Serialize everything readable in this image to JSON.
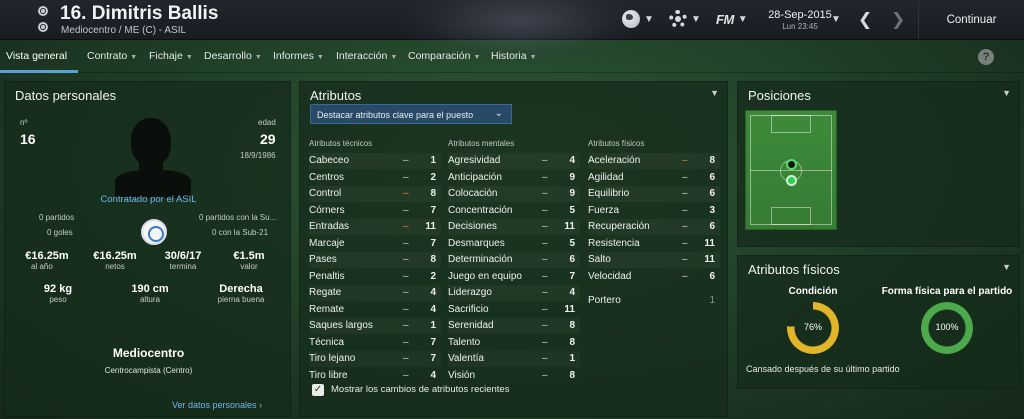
{
  "header": {
    "player_name": "16. Dimitris Ballis",
    "player_subtitle": "Mediocentro / ME (C) - ASIL",
    "date": "28-Sep-2015",
    "time": "Lun 23:45",
    "fm_label": "FM",
    "continue_label": "Continuar",
    "icons": [
      "globe-icon",
      "gear-icon",
      "fm-logo",
      "back-arrow-icon",
      "forward-arrow-icon"
    ]
  },
  "tabs": [
    {
      "label": "Vista general",
      "active": true
    },
    {
      "label": "Contrato"
    },
    {
      "label": "Fichaje"
    },
    {
      "label": "Desarrollo"
    },
    {
      "label": "Informes"
    },
    {
      "label": "Interacción"
    },
    {
      "label": "Comparación"
    },
    {
      "label": "Historia"
    }
  ],
  "help_label": "?",
  "personal": {
    "title": "Datos personales",
    "number_label": "nº",
    "number": "16",
    "age_label": "edad",
    "age": "29",
    "birthdate": "18/9/1986",
    "contract_text": "Contratado por el ASIL",
    "left_stats": [
      "0 partidos",
      "0 goles"
    ],
    "right_stats": [
      "0 partidos con la Su...",
      "0 con la Sub-21"
    ],
    "money": [
      {
        "value": "€16.25m",
        "label": "al año"
      },
      {
        "value": "€16.25m",
        "label": "netos"
      },
      {
        "value": "30/6/17",
        "label": "termina"
      },
      {
        "value": "€1.5m",
        "label": "valor"
      }
    ],
    "body": [
      {
        "value": "92 kg",
        "label": "peso"
      },
      {
        "value": "190 cm",
        "label": "altura"
      },
      {
        "value": "Derecha",
        "label": "pierna buena"
      }
    ],
    "position": "Mediocentro",
    "position_detail": "Centrocampista (Centro)",
    "more_link": "Ver datos personales"
  },
  "attributes": {
    "title": "Atributos",
    "highlight_button": "Destacar atributos clave para el puesto",
    "technical_header": "Atributos técnicos",
    "mental_header": "Atributos mentales",
    "physical_header": "Atributos físicos",
    "technical": [
      {
        "name": "Cabeceo",
        "trend": "–",
        "value": "1"
      },
      {
        "name": "Centros",
        "trend": "–",
        "value": "2"
      },
      {
        "name": "Control",
        "trend": "–",
        "value": "8",
        "trend_color": "orange"
      },
      {
        "name": "Córners",
        "trend": "–",
        "value": "7"
      },
      {
        "name": "Entradas",
        "trend": "–",
        "value": "11",
        "trend_color": "orange"
      },
      {
        "name": "Marcaje",
        "trend": "–",
        "value": "7"
      },
      {
        "name": "Pases",
        "trend": "–",
        "value": "8"
      },
      {
        "name": "Penaltis",
        "trend": "–",
        "value": "2"
      },
      {
        "name": "Regate",
        "trend": "–",
        "value": "4"
      },
      {
        "name": "Remate",
        "trend": "–",
        "value": "4"
      },
      {
        "name": "Saques largos",
        "trend": "–",
        "value": "1"
      },
      {
        "name": "Técnica",
        "trend": "–",
        "value": "7"
      },
      {
        "name": "Tiro lejano",
        "trend": "–",
        "value": "7"
      },
      {
        "name": "Tiro libre",
        "trend": "–",
        "value": "4"
      }
    ],
    "mental": [
      {
        "name": "Agresividad",
        "trend": "–",
        "value": "4"
      },
      {
        "name": "Anticipación",
        "trend": "–",
        "value": "9"
      },
      {
        "name": "Colocación",
        "trend": "–",
        "value": "9"
      },
      {
        "name": "Concentración",
        "trend": "–",
        "value": "5"
      },
      {
        "name": "Decisiones",
        "trend": "–",
        "value": "11"
      },
      {
        "name": "Desmarques",
        "trend": "–",
        "value": "5"
      },
      {
        "name": "Determinación",
        "trend": "–",
        "value": "6"
      },
      {
        "name": "Juego en equipo",
        "trend": "–",
        "value": "7"
      },
      {
        "name": "Liderazgo",
        "trend": "–",
        "value": "4"
      },
      {
        "name": "Sacrificio",
        "trend": "–",
        "value": "11"
      },
      {
        "name": "Serenidad",
        "trend": "–",
        "value": "8"
      },
      {
        "name": "Talento",
        "trend": "–",
        "value": "8"
      },
      {
        "name": "Valentía",
        "trend": "–",
        "value": "1"
      },
      {
        "name": "Visión",
        "trend": "–",
        "value": "8"
      }
    ],
    "physical": [
      {
        "name": "Aceleración",
        "trend": "–",
        "value": "8",
        "trend_color": "orange"
      },
      {
        "name": "Agilidad",
        "trend": "–",
        "value": "6"
      },
      {
        "name": "Equilibrio",
        "trend": "–",
        "value": "6"
      },
      {
        "name": "Fuerza",
        "trend": "–",
        "value": "3"
      },
      {
        "name": "Recuperación",
        "trend": "–",
        "value": "6"
      },
      {
        "name": "Resistencia",
        "trend": "–",
        "value": "11"
      },
      {
        "name": "Salto",
        "trend": "–",
        "value": "11"
      },
      {
        "name": "Velocidad",
        "trend": "–",
        "value": "6"
      }
    ],
    "goalkeeper": {
      "name": "Portero",
      "value": "1"
    },
    "show_changes_label": "Mostrar los cambios de atributos recientes",
    "show_changes_checked": true
  },
  "positions": {
    "title": "Posiciones",
    "pitch_color": "#3e8a3a",
    "natural_color": "#25d44a"
  },
  "physical": {
    "title": "Atributos físicos",
    "condition_label": "Condición",
    "condition_value": "76%",
    "condition_fraction": 0.76,
    "condition_color": "#e3b629",
    "fitness_label": "Forma física para el partido",
    "fitness_value": "100%",
    "fitness_fraction": 1.0,
    "fitness_color": "#4caa4c",
    "note": "Cansado después de su último partido"
  },
  "colors": {
    "accent_blue": "#5aa0d8",
    "trend_orange": "#e8822a",
    "link_blue": "#6db7ee"
  }
}
